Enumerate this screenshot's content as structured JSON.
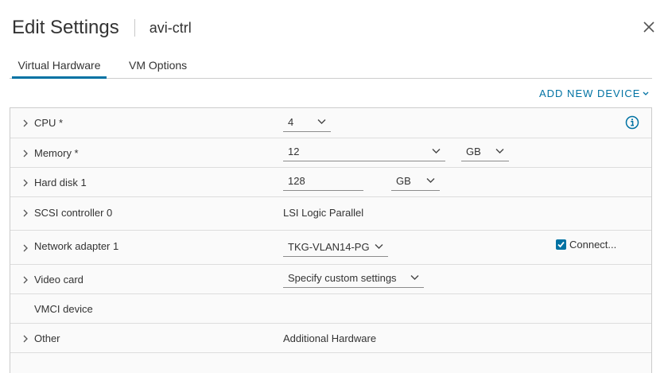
{
  "header": {
    "title": "Edit Settings",
    "vm_name": "avi-ctrl"
  },
  "tabs": [
    {
      "label": "Virtual Hardware",
      "active": true
    },
    {
      "label": "VM Options",
      "active": false
    }
  ],
  "add_device_label": "ADD NEW DEVICE",
  "rows": {
    "cpu": {
      "label": "CPU *",
      "value": "4"
    },
    "memory": {
      "label": "Memory *",
      "value": "12",
      "unit": "GB"
    },
    "hard_disk": {
      "label": "Hard disk 1",
      "value": "128",
      "unit": "GB"
    },
    "scsi": {
      "label": "SCSI controller 0",
      "value": "LSI Logic Parallel"
    },
    "network": {
      "label": "Network adapter 1",
      "value": "TKG-VLAN14-PG",
      "connect_label": "Connect...",
      "connected": true
    },
    "video": {
      "label": "Video card",
      "value": "Specify custom settings"
    },
    "vmci": {
      "label": "VMCI device"
    },
    "other": {
      "label": "Other",
      "value": "Additional Hardware"
    }
  },
  "colors": {
    "accent": "#0072a3",
    "text": "#333333",
    "border": "#cccccc"
  },
  "icons": {
    "close": "close-icon",
    "expand": "chevron-right-icon",
    "dropdown": "chevron-down-icon",
    "info": "info-icon",
    "check": "checkmark-icon"
  }
}
